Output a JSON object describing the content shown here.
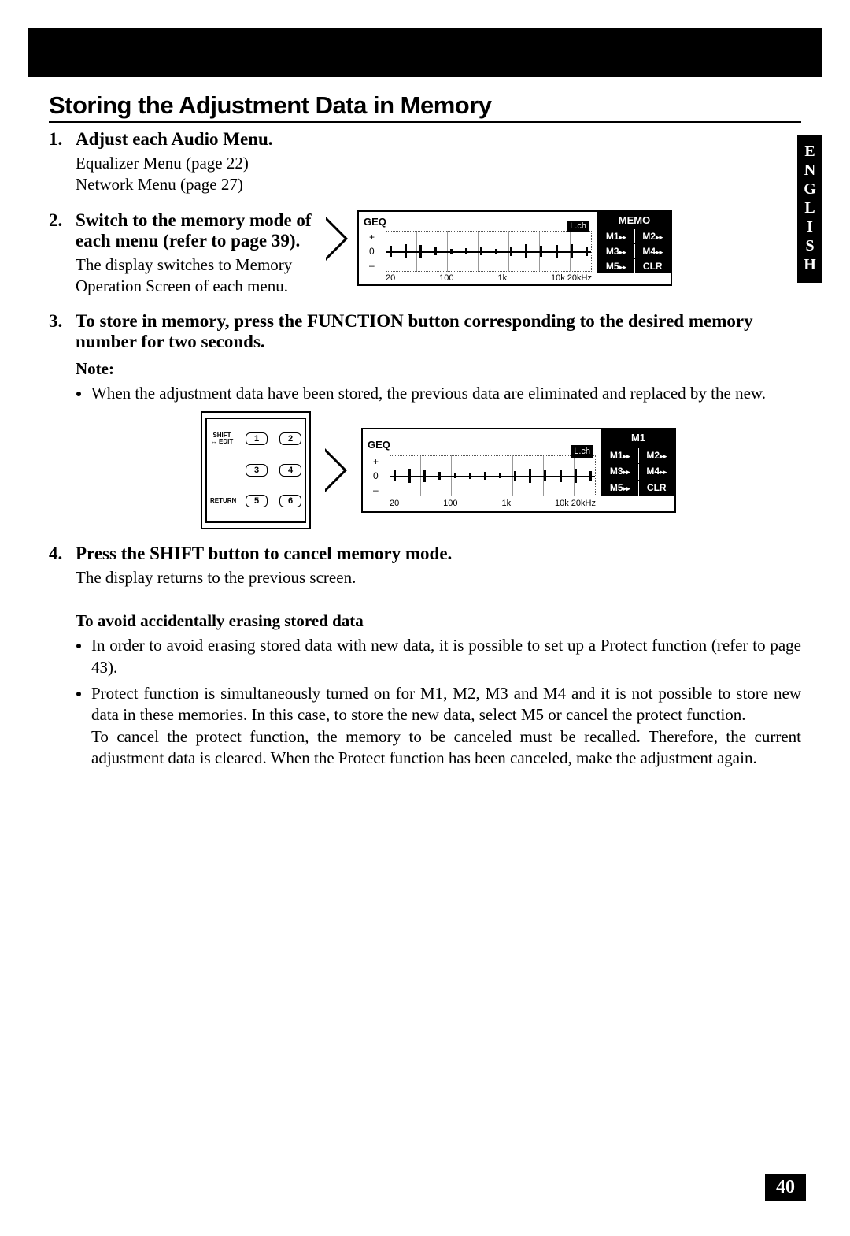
{
  "language_tab": "ENGLISH",
  "page_number": "40",
  "title": "Storing the Adjustment Data in Memory",
  "steps": {
    "s1": {
      "num": "1.",
      "head": "Adjust each Audio Menu.",
      "body1": "Equalizer Menu (page 22)",
      "body2": "Network Menu (page 27)"
    },
    "s2": {
      "num": "2.",
      "head": "Switch to the memory mode of each menu (refer to page 39).",
      "body": "The display switches to Memory Operation Screen of each menu."
    },
    "s3": {
      "num": "3.",
      "head": "To store in memory, press the FUNCTION button corresponding to the desired memory number for two seconds.",
      "note_label": "Note:",
      "note_bullet": "When the adjustment data have been stored, the previous data are eliminated and replaced by the new."
    },
    "s4": {
      "num": "4.",
      "head": "Press the SHIFT button to cancel memory mode.",
      "body": "The display returns to the previous screen."
    }
  },
  "avoid": {
    "head": "To avoid accidentally erasing stored data",
    "b1": "In order to avoid erasing stored data with new data, it is possible to set up a Protect function (refer to page 43).",
    "b2": "Protect function is simultaneously turned on for M1, M2, M3 and M4 and it is not possible to store new data in these memories. In this case, to store the new data, select M5 or cancel the protect function.",
    "b2b": "To cancel the protect function, the memory to be canceled must be recalled. Therefore, the current adjustment data is cleared. When the Protect function has been canceled, make the adjustment again."
  },
  "geq": {
    "label": "GEQ",
    "lch": "L.ch",
    "plus": "+",
    "zero": "0",
    "minus": "–",
    "freq": {
      "a": "20",
      "b": "100",
      "c": "1k",
      "d": "10k 20kHz"
    },
    "memo": "MEMO",
    "m1": "M1",
    "m2": "M2",
    "m3": "M3",
    "m4": "M4",
    "m5": "M5",
    "clr": "CLR",
    "m1_big": "M1"
  },
  "remote": {
    "shift": "SHIFT",
    "edit": "↔ EDIT",
    "return": "RETURN",
    "b1": "1",
    "b2": "2",
    "b3": "3",
    "b4": "4",
    "b5": "5",
    "b6": "6"
  }
}
